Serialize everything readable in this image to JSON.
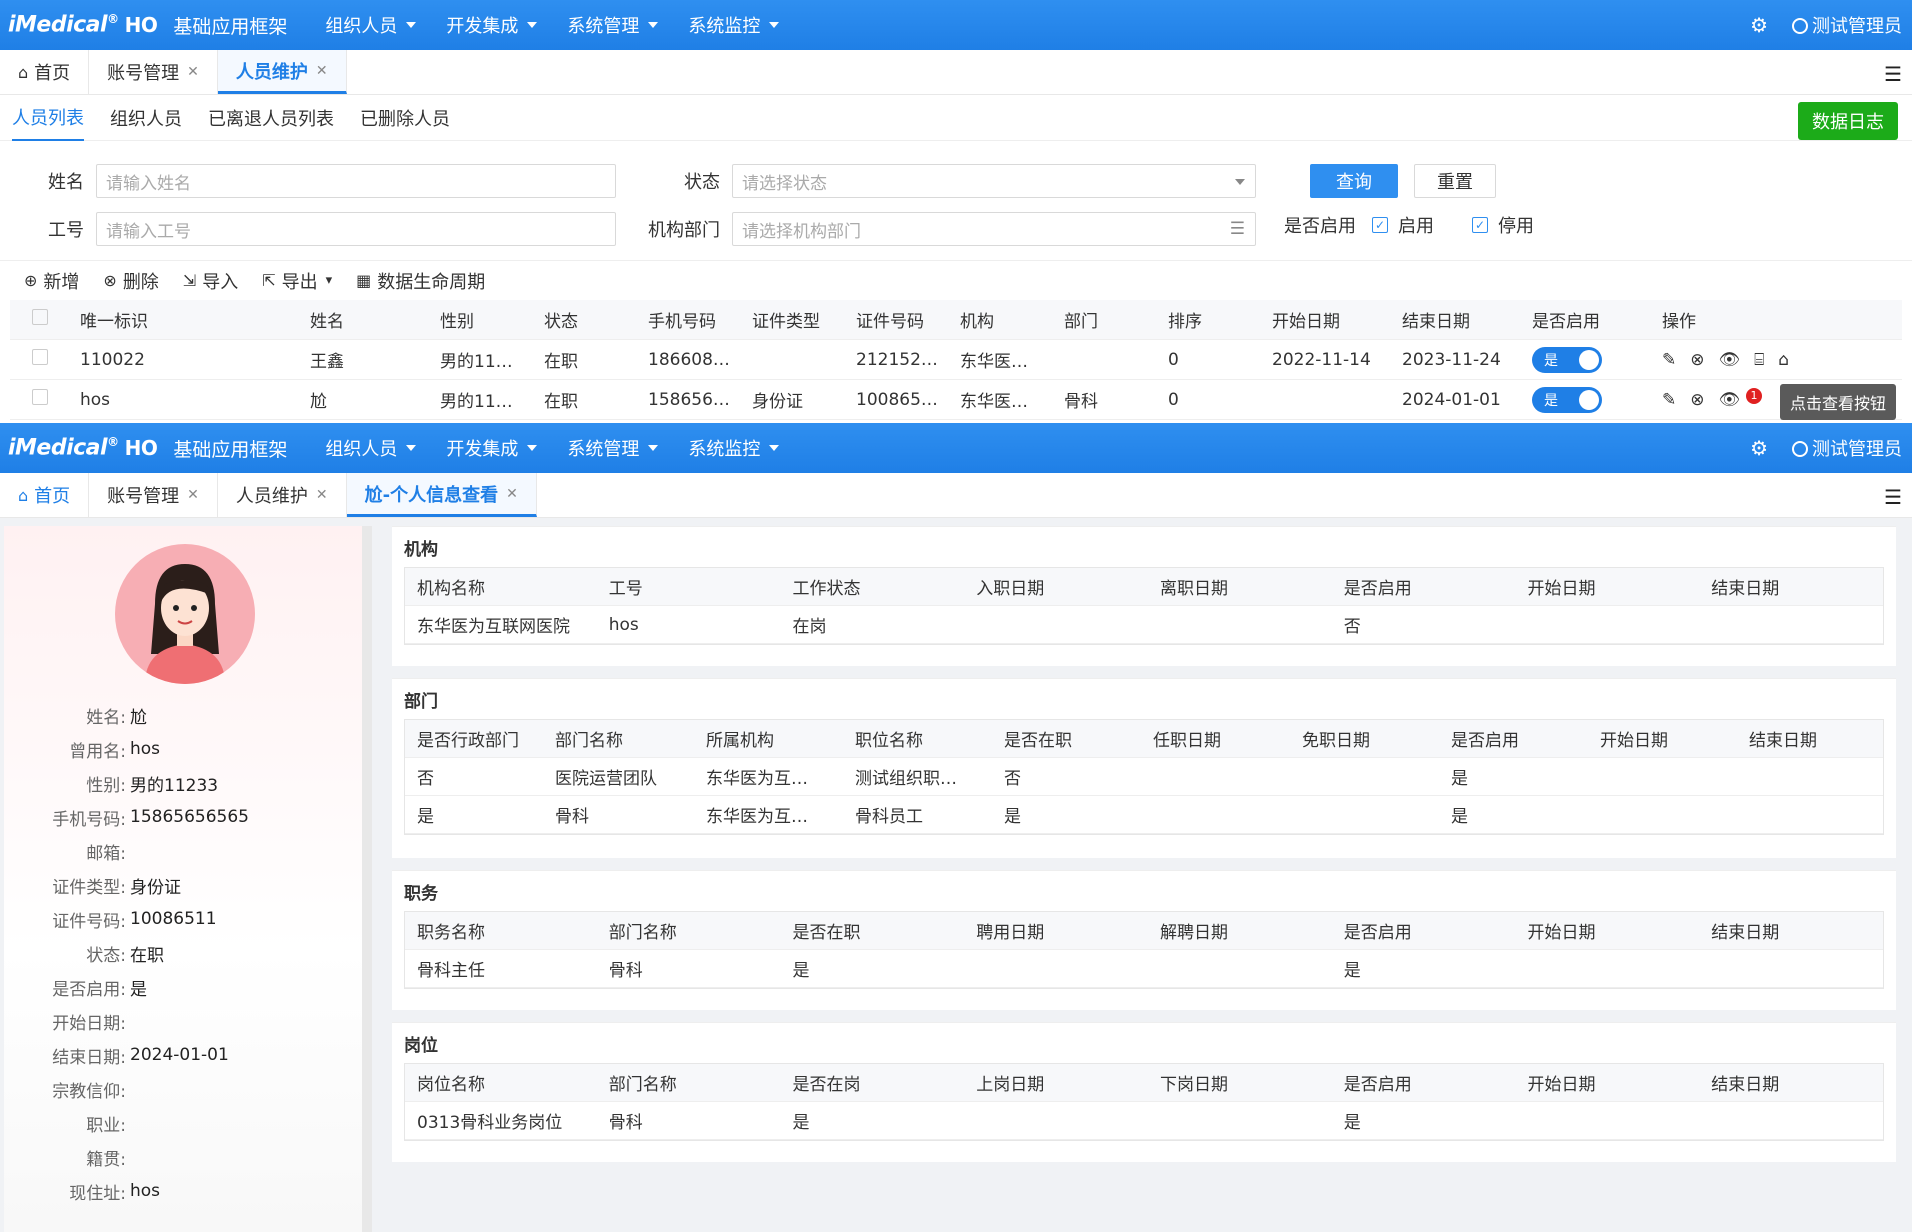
{
  "top": {
    "logo": "iMedical",
    "reg": "®",
    "ho": "HO",
    "app_title": "基础应用框架",
    "menus": [
      "组织人员",
      "开发集成",
      "系统管理",
      "系统监控"
    ],
    "user": "测试管理员"
  },
  "screen1": {
    "tabs": {
      "home": "首页",
      "t1": "账号管理",
      "t2": "人员维护"
    },
    "subtabs": [
      "人员列表",
      "组织人员",
      "已离退人员列表",
      "已删除人员"
    ],
    "data_log_btn": "数据日志",
    "form": {
      "name_label": "姓名",
      "name_ph": "请输入姓名",
      "status_label": "状态",
      "status_ph": "请选择状态",
      "query": "查询",
      "reset": "重置",
      "code_label": "工号",
      "code_ph": "请输入工号",
      "dept_label": "机构部门",
      "dept_ph": "请选择机构部门",
      "enable_label": "是否启用",
      "enabled": "启用",
      "disabled": "停用"
    },
    "toolbar": [
      "新增",
      "删除",
      "导入",
      "导出",
      "数据生命周期"
    ],
    "columns": [
      "唯一标识",
      "姓名",
      "性别",
      "状态",
      "手机号码",
      "证件类型",
      "证件号码",
      "机构",
      "部门",
      "排序",
      "开始日期",
      "结束日期",
      "是否启用",
      "操作"
    ],
    "rows": [
      [
        "110022",
        "王鑫",
        "男的11…",
        "在职",
        "186608…",
        "",
        "212152…",
        "东华医…",
        "",
        "0",
        "2022-11-14",
        "2023-11-24"
      ],
      [
        "hos",
        "尬",
        "男的11…",
        "在职",
        "158656…",
        "身份证",
        "100865…",
        "东华医…",
        "骨科",
        "0",
        "",
        "2024-01-01"
      ]
    ],
    "switch_label": "是",
    "tooltip": "点击查看按钮",
    "badge": "1"
  },
  "screen2": {
    "tabs": {
      "home": "首页",
      "t1": "账号管理",
      "t2": "人员维护",
      "t3": "尬-个人信息查看"
    },
    "profile": [
      [
        "姓名:",
        "尬"
      ],
      [
        "曾用名:",
        "hos"
      ],
      [
        "性别:",
        "男的11233"
      ],
      [
        "手机号码:",
        "15865656565"
      ],
      [
        "邮箱:",
        ""
      ],
      [
        "证件类型:",
        "身份证"
      ],
      [
        "证件号码:",
        "10086511"
      ],
      [
        "状态:",
        "在职"
      ],
      [
        "是否启用:",
        "是"
      ],
      [
        "开始日期:",
        ""
      ],
      [
        "结束日期:",
        "2024-01-01"
      ],
      [
        "宗教信仰:",
        ""
      ],
      [
        "职业:",
        ""
      ],
      [
        "籍贯:",
        ""
      ],
      [
        "现住址:",
        "hos"
      ]
    ],
    "org": {
      "title": "机构",
      "cols": [
        "机构名称",
        "工号",
        "工作状态",
        "入职日期",
        "离职日期",
        "是否启用",
        "开始日期",
        "结束日期"
      ],
      "rows": [
        [
          "东华医为互联网医院",
          "hos",
          "在岗",
          "",
          "",
          "否",
          "",
          ""
        ]
      ]
    },
    "dept": {
      "title": "部门",
      "cols": [
        "是否行政部门",
        "部门名称",
        "所属机构",
        "职位名称",
        "是否在职",
        "任职日期",
        "免职日期",
        "是否启用",
        "开始日期",
        "结束日期"
      ],
      "rows": [
        [
          "否",
          "医院运营团队",
          "东华医为互…",
          "测试组织职…",
          "否",
          "",
          "",
          "是",
          "",
          ""
        ],
        [
          "是",
          "骨科",
          "东华医为互…",
          "骨科员工",
          "是",
          "",
          "",
          "是",
          "",
          ""
        ]
      ]
    },
    "duty": {
      "title": "职务",
      "cols": [
        "职务名称",
        "部门名称",
        "是否在职",
        "聘用日期",
        "解聘日期",
        "是否启用",
        "开始日期",
        "结束日期"
      ],
      "rows": [
        [
          "骨科主任",
          "骨科",
          "是",
          "",
          "",
          "是",
          "",
          ""
        ]
      ]
    },
    "post": {
      "title": "岗位",
      "cols": [
        "岗位名称",
        "部门名称",
        "是否在岗",
        "上岗日期",
        "下岗日期",
        "是否启用",
        "开始日期",
        "结束日期"
      ],
      "rows": [
        [
          "0313骨科业务岗位",
          "骨科",
          "是",
          "",
          "",
          "是",
          "",
          ""
        ]
      ]
    }
  }
}
